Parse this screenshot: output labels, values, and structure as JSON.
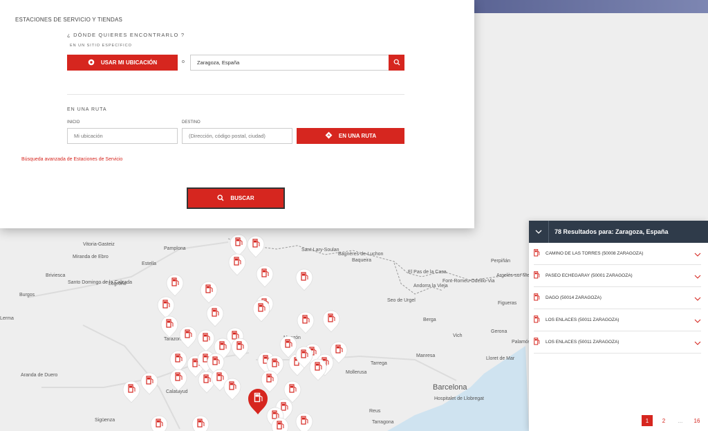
{
  "search_panel": {
    "section_title": "ESTACIONES DE SERVICIO Y TIENDAS",
    "question": "¿ DÓNDE QUIERES ENCONTRARLO ?",
    "subquestion": "EN UN SITIO ESPECÍFICO",
    "use_location_label": "USAR MI UBICACIÓN",
    "or_label": "o",
    "city_value": "Zaragoza, España",
    "route_title": "EN UNA RUTA",
    "start_label": "INICIO",
    "dest_label": "DESTINO",
    "start_placeholder": "Mi ubicación",
    "dest_placeholder": "(Dirección, código postal, ciudad)",
    "route_button_label": "EN UNA RUTA",
    "advanced_link": "Búsqueda avanzada de Estaciones de Servicio",
    "search_button_label": "BUSCAR"
  },
  "results": {
    "header": "78 Resultados para: Zaragoza, España",
    "items": [
      {
        "name": "CAMINO DE LAS TORRES (50008 ZARAGOZA)"
      },
      {
        "name": "PASEO ECHEGARAY (50001 ZARAGOZA)"
      },
      {
        "name": "DAGO (50014 ZARAGOZA)"
      },
      {
        "name": "LOS ENLACES (50011 ZARAGOZA)"
      },
      {
        "name": "LOS ENLACES (50011 ZARAGOZA)"
      }
    ],
    "pages": [
      "1",
      "2",
      "...",
      "16"
    ],
    "current_page": "1"
  },
  "map": {
    "labels": [
      "Vitoria-Gasteiz",
      "Pamplona",
      "Miranda de Ebro",
      "Estella",
      "Briviesca",
      "Logroño",
      "Santo Domingo de la Calzada",
      "Burgos",
      "Lerma",
      "Aranda de Duero",
      "Sigüenza",
      "Calatayud",
      "Tarazona",
      "Sant-Lary-Soulan",
      "Bagnères-de-Luchon",
      "Baqueira",
      "El Pas de la Casa",
      "Andorra la Vieja",
      "Seo de Urgel",
      "Font-Romeu-Odeillo-Via",
      "Perpiñán",
      "Argelès-sur-Mer",
      "Figueras",
      "Berga",
      "Vich",
      "Gerona",
      "Monzón",
      "Manresa",
      "Tarrega",
      "Lloret de Mar",
      "Barcelona",
      "Hospitalet de Llobregat",
      "Reus",
      "Tarragona",
      "Mollerusa",
      "Palamós"
    ],
    "accent": "#d6261f"
  },
  "colors": {
    "accent": "#d6261f",
    "header_dark": "#2f3b4a"
  }
}
